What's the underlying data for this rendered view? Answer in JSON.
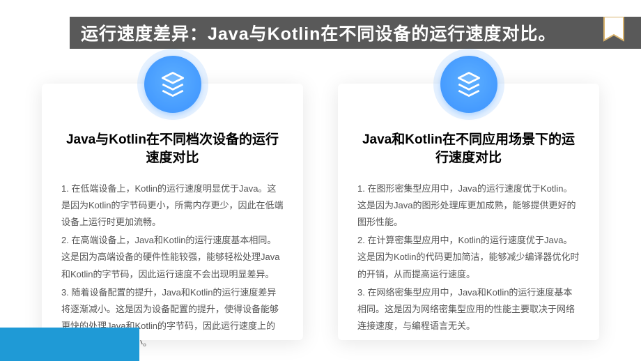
{
  "header": {
    "title": "运行速度差异：Java与Kotlin在不同设备的运行速度对比。"
  },
  "cards": [
    {
      "icon": "layers-icon",
      "title": "Java与Kotlin在不同档次设备的运行速度对比",
      "paragraphs": [
        "1. 在低端设备上，Kotlin的运行速度明显优于Java。这是因为Kotlin的字节码更小，所需内存更少，因此在低端设备上运行时更加流畅。",
        "2. 在高端设备上，Java和Kotlin的运行速度基本相同。这是因为高端设备的硬件性能较强，能够轻松处理Java和Kotlin的字节码，因此运行速度不会出现明显差异。",
        "3. 随着设备配置的提升，Java和Kotlin的运行速度差异将逐渐减小。这是因为设备配置的提升，使得设备能够更快的处理Java和Kotlin的字节码，因此运行速度上的差异将被进一步缩小。"
      ]
    },
    {
      "icon": "layers-icon",
      "title": "Java和Kotlin在不同应用场景下的运行速度对比",
      "paragraphs": [
        "1. 在图形密集型应用中，Java的运行速度优于Kotlin。这是因为Java的图形处理库更加成熟，能够提供更好的图形性能。",
        "2. 在计算密集型应用中，Kotlin的运行速度优于Java。这是因为Kotlin的代码更加简洁，能够减少编译器优化时的开销，从而提高运行速度。",
        "3. 在网络密集型应用中，Java和Kotlin的运行速度基本相同。这是因为网络密集型应用的性能主要取决于网络连接速度，与编程语言无关。"
      ]
    }
  ]
}
